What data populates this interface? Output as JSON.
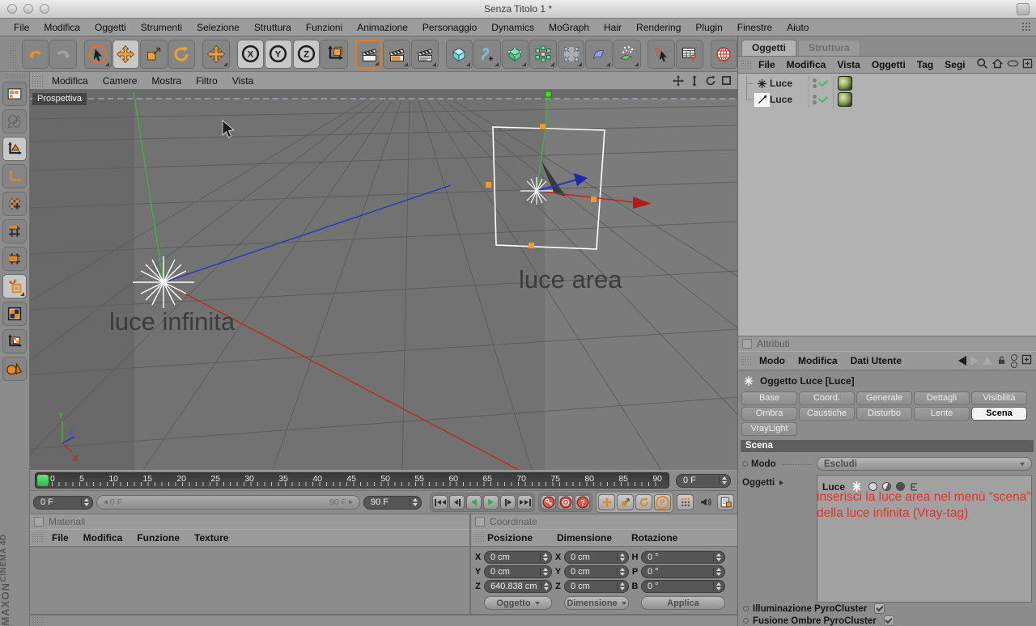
{
  "window": {
    "title": "Senza Titolo 1 *"
  },
  "menubar": {
    "items": [
      "File",
      "Modifica",
      "Oggetti",
      "Strumenti",
      "Selezione",
      "Struttura",
      "Funzioni",
      "Animazione",
      "Personaggio",
      "Dynamics",
      "MoGraph",
      "Hair",
      "Rendering",
      "Plugin",
      "Finestre",
      "Aiuto"
    ]
  },
  "toolbar": {
    "axis_locks": [
      "X",
      "Y",
      "Z"
    ]
  },
  "icons": {
    "help_glyph": "?",
    "browser_glyph": "?",
    "record_question_glyph": "?",
    "parameter_glyph": "P"
  },
  "viewport": {
    "menu": [
      "Modifica",
      "Camere",
      "Mostra",
      "Filtro",
      "Vista"
    ],
    "camera_label": "Prospettiva",
    "labels": {
      "infinite_light": "luce infinita",
      "area_light": "luce area"
    },
    "axis_gizmo": {
      "x": "X",
      "y": "Y",
      "z": "Z"
    }
  },
  "timeline": {
    "ticks": [
      "0",
      "5",
      "10",
      "15",
      "20",
      "25",
      "30",
      "35",
      "40",
      "45",
      "50",
      "55",
      "60",
      "65",
      "70",
      "75",
      "80",
      "85",
      "90"
    ],
    "current_frame": "0 F",
    "range_start": "0 F",
    "range_end": "90 F",
    "end_frame": "90 F"
  },
  "materials_panel": {
    "title": "Materiali",
    "menu": [
      "File",
      "Modifica",
      "Funzione",
      "Texture"
    ]
  },
  "coordinates_panel": {
    "title": "Coordinate",
    "columns": [
      "Posizione",
      "Dimensione",
      "Rotazione"
    ],
    "position": {
      "x_label": "X",
      "x": "0 cm",
      "y_label": "Y",
      "y": "0 cm",
      "z_label": "Z",
      "z": "640.838 cm"
    },
    "size": {
      "x_label": "X",
      "x": "0 cm",
      "y_label": "Y",
      "y": "0 cm",
      "z_label": "Z",
      "z": "0 cm"
    },
    "rotation": {
      "h_label": "H",
      "h": "0 °",
      "p_label": "P",
      "p": "0 °",
      "b_label": "B",
      "b": "0 °"
    },
    "buttons": {
      "object": "Oggetto",
      "size": "Dimensione",
      "apply": "Applica"
    }
  },
  "object_manager": {
    "tabs": [
      "Oggetti",
      "Struttura"
    ],
    "menu": [
      "File",
      "Modifica",
      "Vista",
      "Oggetti",
      "Tag",
      "Segi"
    ],
    "objects": [
      {
        "name": "Luce",
        "type": "infinite-light"
      },
      {
        "name": "Luce",
        "type": "area-light"
      }
    ]
  },
  "attributes_panel": {
    "title": "Attributi",
    "menu": [
      "Modo",
      "Modifica",
      "Dati Utente"
    ],
    "object_title": "Oggetto Luce [Luce]",
    "tabs": [
      "Base",
      "Coord.",
      "Generale",
      "Dettagli",
      "Visibilità",
      "Ombra",
      "Caustiche",
      "Disturbo",
      "Lente",
      "Scena",
      "VrayLight"
    ],
    "active_tab": "Scena",
    "section": {
      "title": "Scena",
      "mode_label": "Modo",
      "mode_value": "Escludi",
      "objects_label": "Oggetti",
      "objects": [
        {
          "name": "Luce"
        }
      ]
    },
    "note": {
      "line1": "inserisci la luce area nel menù “scena”",
      "line2": "della luce infinita (Vray-tag)",
      "color": "#e23427"
    },
    "options": [
      {
        "label": "Illuminazione PyroCluster",
        "checked": true
      },
      {
        "label": "Fusione Ombre PyroCluster",
        "checked": true
      }
    ]
  },
  "branding": {
    "line1": "MAXON",
    "line2": "CINEMA 4D"
  },
  "colors": {
    "accent_orange": "#eca13b",
    "axis_green": "#3db33a",
    "axis_red": "#c0261d",
    "axis_blue": "#2633c8",
    "marker_green": "#3fd75b",
    "note_red": "#e23427",
    "viewport_gray": "#6f6f6f"
  }
}
